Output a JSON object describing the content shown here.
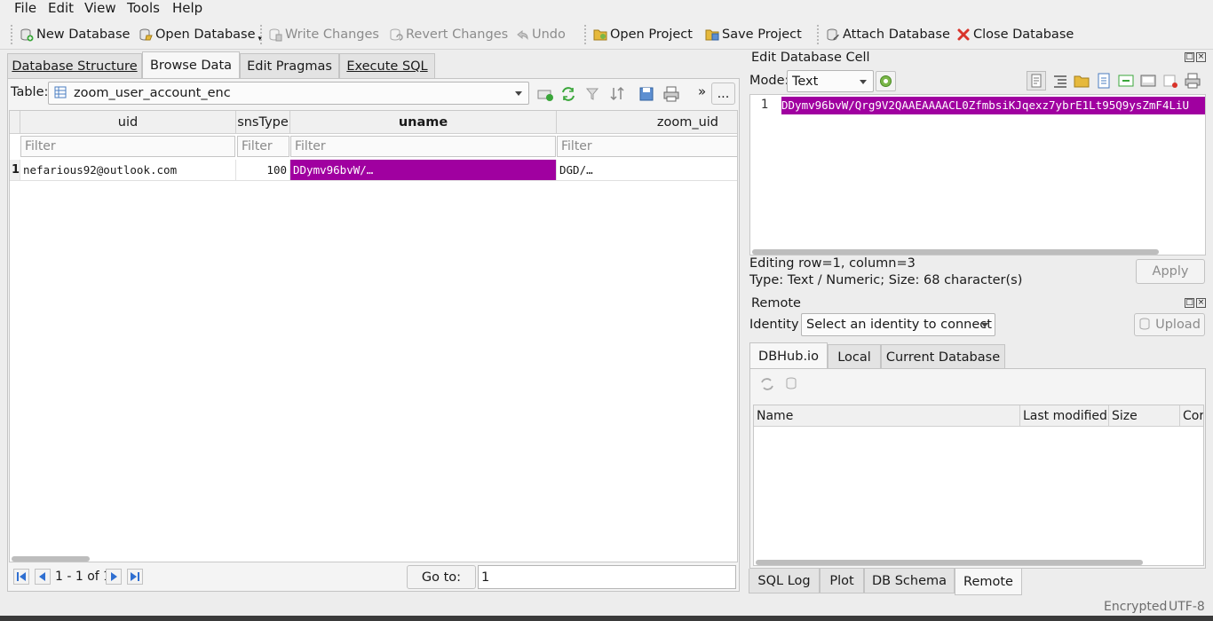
{
  "menu": [
    "File",
    "Edit",
    "View",
    "Tools",
    "Help"
  ],
  "toolbar": {
    "new_database": "New Database",
    "open_database": "Open Database",
    "write_changes": "Write Changes",
    "revert_changes": "Revert Changes",
    "undo": "Undo",
    "open_project": "Open Project",
    "save_project": "Save Project",
    "attach_database": "Attach Database",
    "close_database": "Close Database"
  },
  "tabs": [
    "Database Structure",
    "Browse Data",
    "Edit Pragmas",
    "Execute SQL"
  ],
  "browse": {
    "table_label": "Table:",
    "table_name": "zoom_user_account_enc",
    "more": "»",
    "ellipsis": "...",
    "columns": [
      "uid",
      "snsType",
      "uname",
      "zoom_uid"
    ],
    "filter_placeholder": "Filter",
    "rows": [
      {
        "num": "1",
        "uid": "nefarious92@outlook.com",
        "snsType": "100",
        "uname": "DDymv96bvW/…",
        "zoom_uid": "DGD/…"
      }
    ],
    "pager_text": "1 - 1 of 1",
    "goto_label": "Go to:",
    "goto_value": "1"
  },
  "edit_cell": {
    "title": "Edit Database Cell",
    "mode_label": "Mode:",
    "mode_value": "Text",
    "line_number": "1",
    "content": "DDymv96bvW/Qrg9V2QAAEAAAACL0ZfmbsiKJqexz7ybrE1Lt95Q9ysZmF4LiU",
    "status_line1": "Editing row=1, column=3",
    "status_line2": "Type: Text / Numeric; Size: 68 character(s)",
    "apply": "Apply"
  },
  "remote": {
    "title": "Remote",
    "identity_label": "Identity",
    "identity_value": "Select an identity to connect",
    "upload": "Upload",
    "tabs": [
      "DBHub.io",
      "Local",
      "Current Database"
    ],
    "columns": [
      "Name",
      "Last modified",
      "Size",
      "Cor"
    ]
  },
  "bottom_tabs": [
    "SQL Log",
    "Plot",
    "DB Schema",
    "Remote"
  ],
  "status": {
    "encrypted": "Encrypted",
    "encoding": "UTF-8"
  },
  "colors": {
    "selection": "#a000a0",
    "close_red": "#d9342b"
  }
}
